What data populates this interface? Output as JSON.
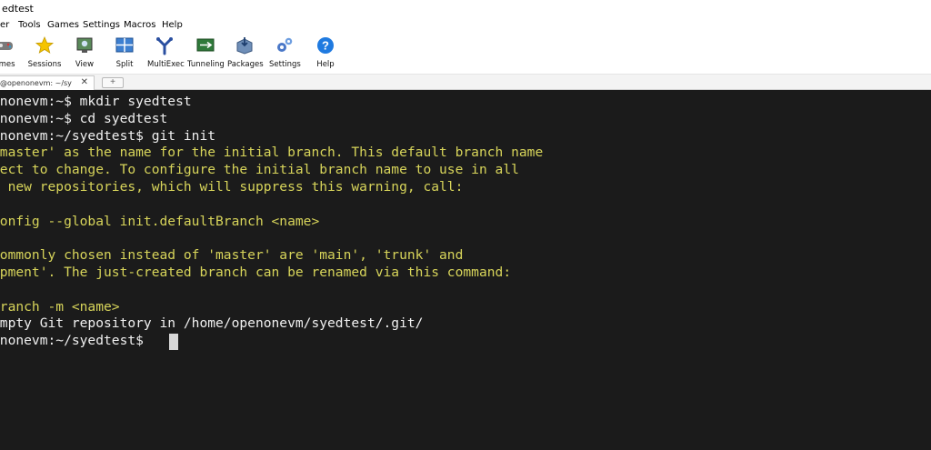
{
  "window": {
    "title": "edtest"
  },
  "menu": [
    "er",
    "Tools",
    "Games",
    "Settings",
    "Macros",
    "Help"
  ],
  "toolbar": [
    {
      "label": "ames",
      "icon": "games-icon"
    },
    {
      "label": "Sessions",
      "icon": "star-icon"
    },
    {
      "label": "View",
      "icon": "view-icon"
    },
    {
      "label": "Split",
      "icon": "split-icon"
    },
    {
      "label": "MultiExec",
      "icon": "multiexec-icon"
    },
    {
      "label": "Tunneling",
      "icon": "tunneling-icon"
    },
    {
      "label": "Packages",
      "icon": "packages-icon"
    },
    {
      "label": "Settings",
      "icon": "gears-icon"
    },
    {
      "label": "Help",
      "icon": "help-icon"
    }
  ],
  "tab": {
    "label": "@openonevm: ~/sy",
    "close": "✕",
    "new_tab": "+"
  },
  "colors": {
    "terminal_bg": "#1b1b1b",
    "prompt_text": "#f0f0f0",
    "hint_text": "#d7d45a"
  },
  "terminal": {
    "lines": [
      {
        "text": "enonevm:~$ mkdir syedtest",
        "color": "white"
      },
      {
        "text": "enonevm:~$ cd syedtest",
        "color": "white"
      },
      {
        "text": "enonevm:~/syedtest$ git init",
        "color": "white"
      },
      {
        "text": "'master' as the name for the initial branch. This default branch name",
        "color": "yellow"
      },
      {
        "text": "ject to change. To configure the initial branch name to use in all",
        "color": "yellow"
      },
      {
        "text": "r new repositories, which will suppress this warning, call:",
        "color": "yellow"
      },
      {
        "text": "",
        "color": "yellow"
      },
      {
        "text": "config --global init.defaultBranch <name>",
        "color": "yellow"
      },
      {
        "text": "",
        "color": "yellow"
      },
      {
        "text": "commonly chosen instead of 'master' are 'main', 'trunk' and",
        "color": "yellow"
      },
      {
        "text": "opment'. The just-created branch can be renamed via this command:",
        "color": "yellow"
      },
      {
        "text": "",
        "color": "yellow"
      },
      {
        "text": "branch -m <name>",
        "color": "yellow"
      },
      {
        "text": "empty Git repository in /home/openonevm/syedtest/.git/",
        "color": "white"
      },
      {
        "text": "enonevm:~/syedtest$ ",
        "color": "white"
      }
    ]
  }
}
